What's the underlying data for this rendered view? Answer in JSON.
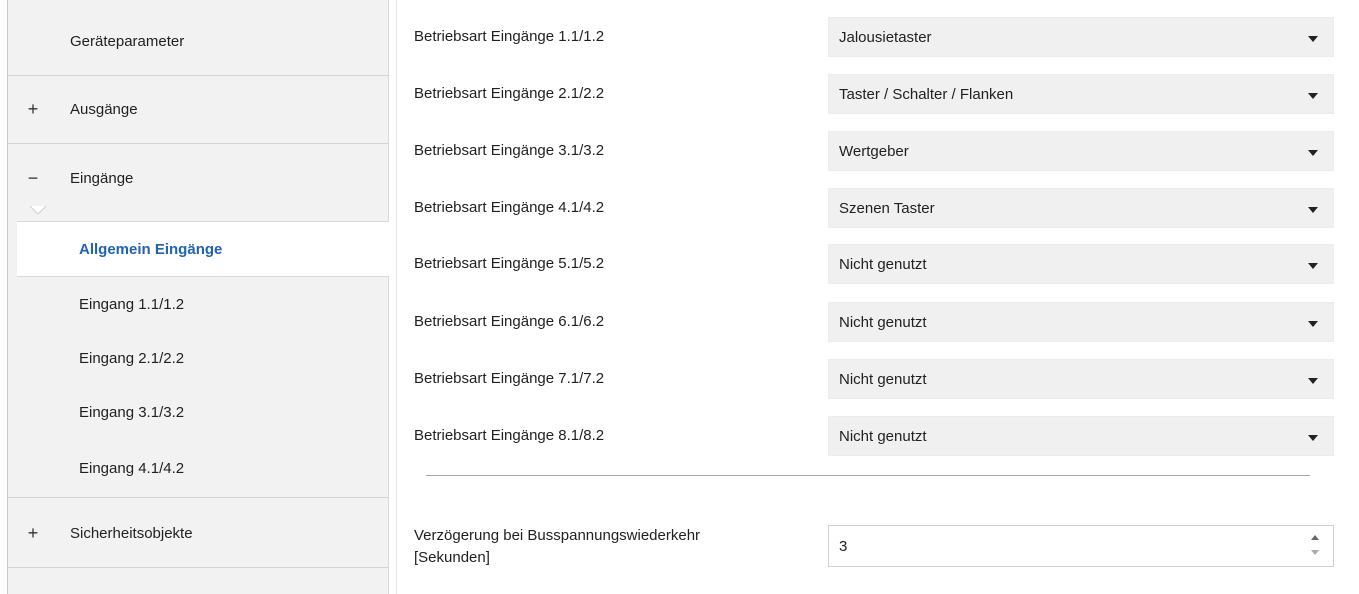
{
  "sidebar": {
    "geraeteparameter": "Geräteparameter",
    "ausgaenge": {
      "sign": "+",
      "label": "Ausgänge"
    },
    "eingaenge": {
      "sign": "−",
      "label": "Eingänge"
    },
    "sub_items": [
      "Allgemein Eingänge",
      "Eingang 1.1/1.2",
      "Eingang 2.1/2.2",
      "Eingang 3.1/3.2",
      "Eingang 4.1/4.2"
    ],
    "sicherheitsobjekte": {
      "sign": "+",
      "label": "Sicherheitsobjekte"
    }
  },
  "params": [
    {
      "label": "Betriebsart Eingänge 1.1/1.2",
      "value": "Jalousietaster"
    },
    {
      "label": "Betriebsart Eingänge 2.1/2.2",
      "value": "Taster / Schalter / Flanken"
    },
    {
      "label": "Betriebsart Eingänge 3.1/3.2",
      "value": "Wertgeber"
    },
    {
      "label": "Betriebsart Eingänge 4.1/4.2",
      "value": "Szenen Taster"
    },
    {
      "label": "Betriebsart Eingänge 5.1/5.2",
      "value": "Nicht genutzt"
    },
    {
      "label": "Betriebsart Eingänge 6.1/6.2",
      "value": "Nicht genutzt"
    },
    {
      "label": "Betriebsart Eingänge 7.1/7.2",
      "value": "Nicht genutzt"
    },
    {
      "label": "Betriebsart Eingänge 8.1/8.2",
      "value": "Nicht genutzt"
    }
  ],
  "delay": {
    "label_line1": "Verzögerung bei Busspannungswiederkehr",
    "label_line2": "[Sekunden]",
    "value": "3"
  },
  "colors": {
    "active_text": "#1e63b4",
    "sidebar_bg": "#f2f2f2",
    "select_bg": "#f0f0f0"
  }
}
